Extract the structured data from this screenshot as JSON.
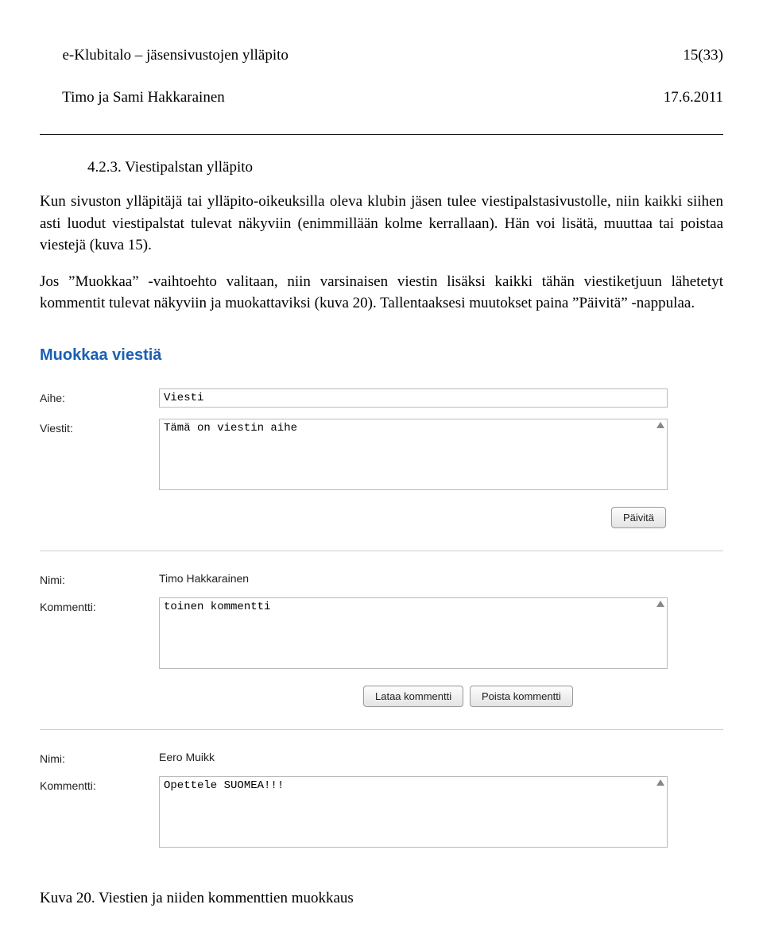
{
  "header": {
    "left_line1": "e-Klubitalo – jäsensivustojen ylläpito",
    "left_line2": "Timo ja Sami Hakkarainen",
    "right_line1": "15(33)",
    "right_line2": "17.6.2011"
  },
  "section": {
    "number_title": "4.2.3.  Viestipalstan ylläpito"
  },
  "paragraphs": {
    "p1": "Kun sivuston ylläpitäjä tai ylläpito-oikeuksilla oleva klubin jäsen tulee viestipalstasivustolle, niin kaikki siihen asti luodut viestipalstat tulevat näkyviin (enimmillään kolme kerrallaan). Hän voi lisätä, muuttaa tai poistaa viestejä (kuva 15).",
    "p2": "Jos ”Muokkaa” -vaihtoehto valitaan, niin varsinaisen viestin lisäksi kaikki tähän viestiketjuun lähetetyt kommentit tulevat näkyviin ja muokattaviksi (kuva 20). Tallentaaksesi muutokset paina ”Päivitä” -nappulaa."
  },
  "form": {
    "title": "Muokkaa viestiä",
    "aihe_label": "Aihe:",
    "aihe_value": "Viesti",
    "viestit_label": "Viestit:",
    "viestit_value": "Tämä on viestin aihe",
    "paivita_label": "Päivitä",
    "nimi_label": "Nimi:",
    "kommentti_label": "Kommentti:",
    "comment1_name": "Timo Hakkarainen",
    "comment1_text": "toinen kommentti",
    "lataa_label": "Lataa kommentti",
    "poista_label": "Poista kommentti",
    "comment2_name": "Eero Muikk",
    "comment2_text": "Opettele SUOMEA!!!"
  },
  "caption": "Kuva 20. Viestien ja niiden kommenttien muokkaus"
}
